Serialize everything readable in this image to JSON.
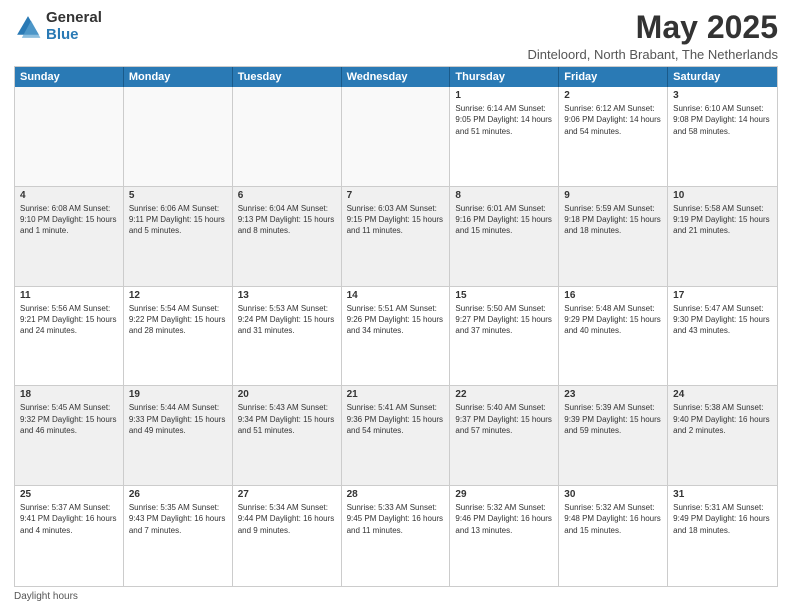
{
  "logo": {
    "general": "General",
    "blue": "Blue"
  },
  "header": {
    "month_title": "May 2025",
    "location": "Dinteloord, North Brabant, The Netherlands"
  },
  "weekdays": [
    "Sunday",
    "Monday",
    "Tuesday",
    "Wednesday",
    "Thursday",
    "Friday",
    "Saturday"
  ],
  "footer": {
    "daylight_label": "Daylight hours"
  },
  "weeks": [
    [
      {
        "day": "",
        "info": ""
      },
      {
        "day": "",
        "info": ""
      },
      {
        "day": "",
        "info": ""
      },
      {
        "day": "",
        "info": ""
      },
      {
        "day": "1",
        "info": "Sunrise: 6:14 AM\nSunset: 9:05 PM\nDaylight: 14 hours\nand 51 minutes."
      },
      {
        "day": "2",
        "info": "Sunrise: 6:12 AM\nSunset: 9:06 PM\nDaylight: 14 hours\nand 54 minutes."
      },
      {
        "day": "3",
        "info": "Sunrise: 6:10 AM\nSunset: 9:08 PM\nDaylight: 14 hours\nand 58 minutes."
      }
    ],
    [
      {
        "day": "4",
        "info": "Sunrise: 6:08 AM\nSunset: 9:10 PM\nDaylight: 15 hours\nand 1 minute."
      },
      {
        "day": "5",
        "info": "Sunrise: 6:06 AM\nSunset: 9:11 PM\nDaylight: 15 hours\nand 5 minutes."
      },
      {
        "day": "6",
        "info": "Sunrise: 6:04 AM\nSunset: 9:13 PM\nDaylight: 15 hours\nand 8 minutes."
      },
      {
        "day": "7",
        "info": "Sunrise: 6:03 AM\nSunset: 9:15 PM\nDaylight: 15 hours\nand 11 minutes."
      },
      {
        "day": "8",
        "info": "Sunrise: 6:01 AM\nSunset: 9:16 PM\nDaylight: 15 hours\nand 15 minutes."
      },
      {
        "day": "9",
        "info": "Sunrise: 5:59 AM\nSunset: 9:18 PM\nDaylight: 15 hours\nand 18 minutes."
      },
      {
        "day": "10",
        "info": "Sunrise: 5:58 AM\nSunset: 9:19 PM\nDaylight: 15 hours\nand 21 minutes."
      }
    ],
    [
      {
        "day": "11",
        "info": "Sunrise: 5:56 AM\nSunset: 9:21 PM\nDaylight: 15 hours\nand 24 minutes."
      },
      {
        "day": "12",
        "info": "Sunrise: 5:54 AM\nSunset: 9:22 PM\nDaylight: 15 hours\nand 28 minutes."
      },
      {
        "day": "13",
        "info": "Sunrise: 5:53 AM\nSunset: 9:24 PM\nDaylight: 15 hours\nand 31 minutes."
      },
      {
        "day": "14",
        "info": "Sunrise: 5:51 AM\nSunset: 9:26 PM\nDaylight: 15 hours\nand 34 minutes."
      },
      {
        "day": "15",
        "info": "Sunrise: 5:50 AM\nSunset: 9:27 PM\nDaylight: 15 hours\nand 37 minutes."
      },
      {
        "day": "16",
        "info": "Sunrise: 5:48 AM\nSunset: 9:29 PM\nDaylight: 15 hours\nand 40 minutes."
      },
      {
        "day": "17",
        "info": "Sunrise: 5:47 AM\nSunset: 9:30 PM\nDaylight: 15 hours\nand 43 minutes."
      }
    ],
    [
      {
        "day": "18",
        "info": "Sunrise: 5:45 AM\nSunset: 9:32 PM\nDaylight: 15 hours\nand 46 minutes."
      },
      {
        "day": "19",
        "info": "Sunrise: 5:44 AM\nSunset: 9:33 PM\nDaylight: 15 hours\nand 49 minutes."
      },
      {
        "day": "20",
        "info": "Sunrise: 5:43 AM\nSunset: 9:34 PM\nDaylight: 15 hours\nand 51 minutes."
      },
      {
        "day": "21",
        "info": "Sunrise: 5:41 AM\nSunset: 9:36 PM\nDaylight: 15 hours\nand 54 minutes."
      },
      {
        "day": "22",
        "info": "Sunrise: 5:40 AM\nSunset: 9:37 PM\nDaylight: 15 hours\nand 57 minutes."
      },
      {
        "day": "23",
        "info": "Sunrise: 5:39 AM\nSunset: 9:39 PM\nDaylight: 15 hours\nand 59 minutes."
      },
      {
        "day": "24",
        "info": "Sunrise: 5:38 AM\nSunset: 9:40 PM\nDaylight: 16 hours\nand 2 minutes."
      }
    ],
    [
      {
        "day": "25",
        "info": "Sunrise: 5:37 AM\nSunset: 9:41 PM\nDaylight: 16 hours\nand 4 minutes."
      },
      {
        "day": "26",
        "info": "Sunrise: 5:35 AM\nSunset: 9:43 PM\nDaylight: 16 hours\nand 7 minutes."
      },
      {
        "day": "27",
        "info": "Sunrise: 5:34 AM\nSunset: 9:44 PM\nDaylight: 16 hours\nand 9 minutes."
      },
      {
        "day": "28",
        "info": "Sunrise: 5:33 AM\nSunset: 9:45 PM\nDaylight: 16 hours\nand 11 minutes."
      },
      {
        "day": "29",
        "info": "Sunrise: 5:32 AM\nSunset: 9:46 PM\nDaylight: 16 hours\nand 13 minutes."
      },
      {
        "day": "30",
        "info": "Sunrise: 5:32 AM\nSunset: 9:48 PM\nDaylight: 16 hours\nand 15 minutes."
      },
      {
        "day": "31",
        "info": "Sunrise: 5:31 AM\nSunset: 9:49 PM\nDaylight: 16 hours\nand 18 minutes."
      }
    ]
  ]
}
